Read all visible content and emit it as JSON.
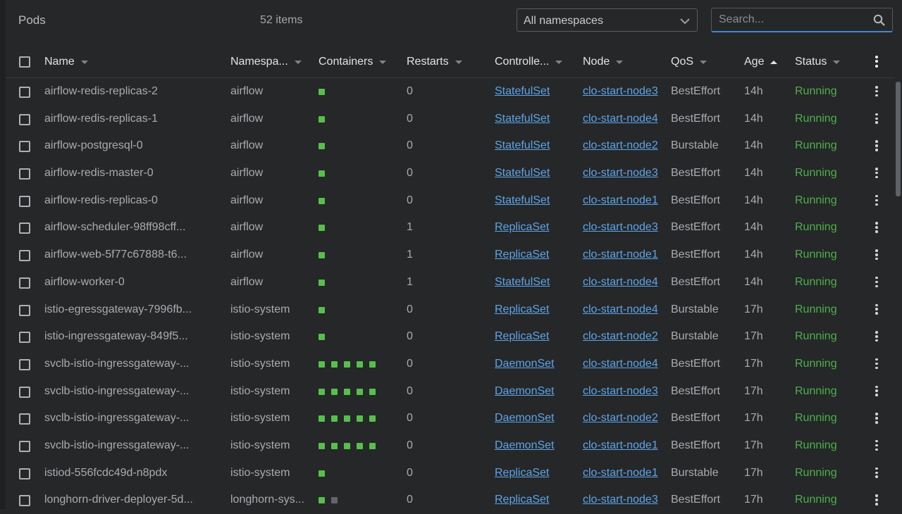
{
  "header": {
    "title": "Pods",
    "count": "52 items",
    "namespace_select": "All namespaces",
    "search_placeholder": "Search..."
  },
  "columns": {
    "name": "Name",
    "namespace": "Namespa...",
    "containers": "Containers",
    "restarts": "Restarts",
    "controller": "Controlle...",
    "node": "Node",
    "qos": "QoS",
    "age": "Age",
    "status": "Status"
  },
  "rows": [
    {
      "name": "airflow-redis-replicas-2",
      "namespace": "airflow",
      "containers": "1",
      "restarts": "0",
      "controller": "StatefulSet",
      "node": "clo-start-node3",
      "qos": "BestEffort",
      "age": "14h",
      "status": "Running"
    },
    {
      "name": "airflow-redis-replicas-1",
      "namespace": "airflow",
      "containers": "1",
      "restarts": "0",
      "controller": "StatefulSet",
      "node": "clo-start-node4",
      "qos": "BestEffort",
      "age": "14h",
      "status": "Running"
    },
    {
      "name": "airflow-postgresql-0",
      "namespace": "airflow",
      "containers": "1",
      "restarts": "0",
      "controller": "StatefulSet",
      "node": "clo-start-node2",
      "qos": "Burstable",
      "age": "14h",
      "status": "Running"
    },
    {
      "name": "airflow-redis-master-0",
      "namespace": "airflow",
      "containers": "1",
      "restarts": "0",
      "controller": "StatefulSet",
      "node": "clo-start-node3",
      "qos": "BestEffort",
      "age": "14h",
      "status": "Running"
    },
    {
      "name": "airflow-redis-replicas-0",
      "namespace": "airflow",
      "containers": "1",
      "restarts": "0",
      "controller": "StatefulSet",
      "node": "clo-start-node1",
      "qos": "BestEffort",
      "age": "14h",
      "status": "Running"
    },
    {
      "name": "airflow-scheduler-98ff98cff...",
      "namespace": "airflow",
      "containers": "1",
      "restarts": "1",
      "controller": "ReplicaSet",
      "node": "clo-start-node3",
      "qos": "BestEffort",
      "age": "14h",
      "status": "Running"
    },
    {
      "name": "airflow-web-5f77c67888-t6...",
      "namespace": "airflow",
      "containers": "1",
      "restarts": "1",
      "controller": "ReplicaSet",
      "node": "clo-start-node1",
      "qos": "BestEffort",
      "age": "14h",
      "status": "Running"
    },
    {
      "name": "airflow-worker-0",
      "namespace": "airflow",
      "containers": "1",
      "restarts": "1",
      "controller": "StatefulSet",
      "node": "clo-start-node4",
      "qos": "BestEffort",
      "age": "14h",
      "status": "Running"
    },
    {
      "name": "istio-egressgateway-7996fb...",
      "namespace": "istio-system",
      "containers": "1",
      "restarts": "0",
      "controller": "ReplicaSet",
      "node": "clo-start-node4",
      "qos": "Burstable",
      "age": "17h",
      "status": "Running"
    },
    {
      "name": "istio-ingressgateway-849f5...",
      "namespace": "istio-system",
      "containers": "1",
      "restarts": "0",
      "controller": "ReplicaSet",
      "node": "clo-start-node2",
      "qos": "Burstable",
      "age": "17h",
      "status": "Running"
    },
    {
      "name": "svclb-istio-ingressgateway-...",
      "namespace": "istio-system",
      "containers": "5",
      "restarts": "0",
      "controller": "DaemonSet",
      "node": "clo-start-node4",
      "qos": "BestEffort",
      "age": "17h",
      "status": "Running"
    },
    {
      "name": "svclb-istio-ingressgateway-...",
      "namespace": "istio-system",
      "containers": "5",
      "restarts": "0",
      "controller": "DaemonSet",
      "node": "clo-start-node3",
      "qos": "BestEffort",
      "age": "17h",
      "status": "Running"
    },
    {
      "name": "svclb-istio-ingressgateway-...",
      "namespace": "istio-system",
      "containers": "5",
      "restarts": "0",
      "controller": "DaemonSet",
      "node": "clo-start-node2",
      "qos": "BestEffort",
      "age": "17h",
      "status": "Running"
    },
    {
      "name": "svclb-istio-ingressgateway-...",
      "namespace": "istio-system",
      "containers": "5",
      "restarts": "0",
      "controller": "DaemonSet",
      "node": "clo-start-node1",
      "qos": "BestEffort",
      "age": "17h",
      "status": "Running"
    },
    {
      "name": "istiod-556fcdc49d-n8pdx",
      "namespace": "istio-system",
      "containers": "1",
      "restarts": "0",
      "controller": "ReplicaSet",
      "node": "clo-start-node1",
      "qos": "Burstable",
      "age": "17h",
      "status": "Running"
    },
    {
      "name": "longhorn-driver-deployer-5d...",
      "namespace": "longhorn-sys...",
      "containers": "1 running, 1 waiting",
      "restarts": "0",
      "controller": "ReplicaSet",
      "node": "clo-start-node3",
      "qos": "BestEffort",
      "age": "17h",
      "status": "Running"
    }
  ],
  "container_dot_counts": [
    {
      "running": 1,
      "waiting": 0
    },
    {
      "running": 1,
      "waiting": 0
    },
    {
      "running": 1,
      "waiting": 0
    },
    {
      "running": 1,
      "waiting": 0
    },
    {
      "running": 1,
      "waiting": 0
    },
    {
      "running": 1,
      "waiting": 0
    },
    {
      "running": 1,
      "waiting": 0
    },
    {
      "running": 1,
      "waiting": 0
    },
    {
      "running": 1,
      "waiting": 0
    },
    {
      "running": 1,
      "waiting": 0
    },
    {
      "running": 5,
      "waiting": 0
    },
    {
      "running": 5,
      "waiting": 0
    },
    {
      "running": 5,
      "waiting": 0
    },
    {
      "running": 5,
      "waiting": 0
    },
    {
      "running": 1,
      "waiting": 0
    },
    {
      "running": 1,
      "waiting": 1
    }
  ],
  "colors": {
    "background": "#252729",
    "running": "#4fb04a",
    "link": "#5fa4e6",
    "accent": "#3e8bd6",
    "container_ok": "#56c04a",
    "container_waiting": "#62666a"
  },
  "icons": {
    "search": "search-icon",
    "dropdown": "chevron-down-icon",
    "menu": "more-vertical-icon",
    "sort": "sort-arrow-icon"
  }
}
